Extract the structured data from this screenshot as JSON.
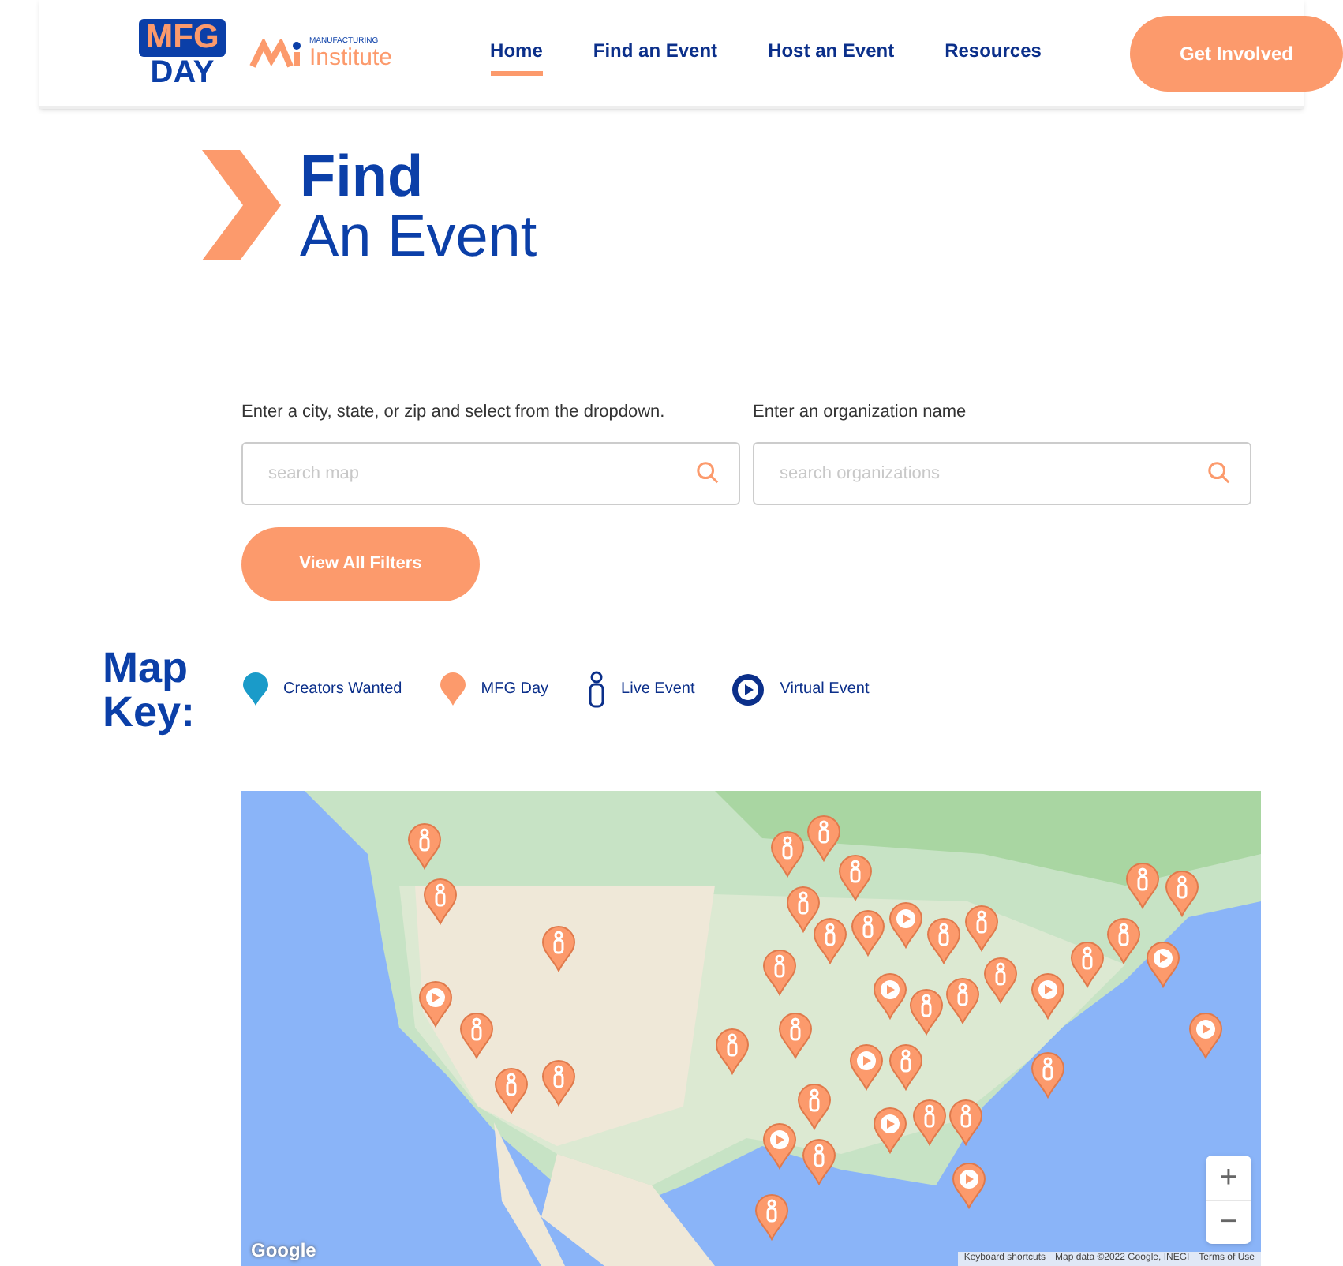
{
  "header": {
    "logo": {
      "top": "MFG",
      "bottom": "DAY"
    },
    "partner_logo": {
      "small": "MANUFACTURING",
      "large": "Institute"
    },
    "nav": [
      {
        "label": "Home",
        "selected": true
      },
      {
        "label": "Find an Event",
        "selected": false
      },
      {
        "label": "Host an Event",
        "selected": false
      },
      {
        "label": "Resources",
        "selected": false
      }
    ],
    "cta": "Get Involved"
  },
  "title": {
    "line_1": "Find",
    "line_2": "An Event"
  },
  "search": [
    {
      "label": "Enter a city, state, or zip and select from the dropdown.",
      "placeholder": "search map"
    },
    {
      "label": "Enter an organization name",
      "placeholder": "search organizations"
    }
  ],
  "filters_button": "View All Filters",
  "map_key": {
    "title_1": "Map",
    "title_2": "Key:",
    "items": [
      {
        "kind": "pin",
        "color": "#1a9bc9",
        "label": "Creators Wanted"
      },
      {
        "kind": "pin",
        "color": "#fc9a6c",
        "label": "MFG Day"
      },
      {
        "kind": "person",
        "color": "#0b2f8a",
        "label": "Live Event"
      },
      {
        "kind": "play",
        "color": "#0b2f8a",
        "label": "Virtual Event"
      }
    ]
  },
  "map": {
    "kind": "picture",
    "zoom_in": "+",
    "zoom_out": "−",
    "logo": "Google",
    "attribution": [
      "Keyboard shortcuts",
      "Map data ©2022 Google, INEGI",
      "Terms of Use"
    ]
  }
}
